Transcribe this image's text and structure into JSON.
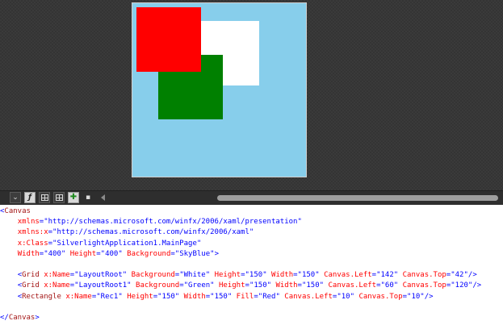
{
  "preview": {
    "canvas_background": "#87CEEB",
    "shapes": [
      {
        "name": "LayoutRoot",
        "fill": "#FFFFFF"
      },
      {
        "name": "LayoutRoot1",
        "fill": "#008000"
      },
      {
        "name": "Rec1",
        "fill": "#FF0000"
      }
    ]
  },
  "toolbar": {
    "buttons": [
      {
        "icon": "chevron-down-icon",
        "glyph": "⌄"
      },
      {
        "icon": "font-icon",
        "glyph": "ƒ"
      },
      {
        "icon": "grid-icon"
      },
      {
        "icon": "grid-snap-icon"
      },
      {
        "icon": "snap-plus-icon",
        "glyph": "✚"
      },
      {
        "icon": "comment-icon",
        "glyph": "▪"
      }
    ],
    "scroll_left_icon": "triangle-left-icon"
  },
  "xaml": {
    "canvas_open": {
      "lt": "<",
      "tag": "Canvas"
    },
    "xmlns": {
      "attr": "xmlns",
      "eq": "=",
      "value": "\"http://schemas.microsoft.com/winfx/2006/xaml/presentation\""
    },
    "xmlns_x": {
      "attr": "xmlns:x",
      "eq": "=",
      "value": "\"http://schemas.microsoft.com/winfx/2006/xaml\""
    },
    "x_class": {
      "attr": "x:Class",
      "eq": "=",
      "value": "\"SilverlightApplication1.MainPage\""
    },
    "size_line": {
      "w_attr": "Width",
      "w_val": "\"400\"",
      "h_attr": "Height",
      "h_val": "\"400\"",
      "bg_attr": "Background",
      "bg_val": "\"SkyBlue\"",
      "gt": ">"
    },
    "grid1": {
      "lt": "<",
      "tag": "Grid",
      "name_attr": "x:Name",
      "name_val": "\"LayoutRoot\"",
      "bg_attr": "Background",
      "bg_val": "\"White\"",
      "h_attr": "Height",
      "h_val": "\"150\"",
      "w_attr": "Width",
      "w_val": "\"150\"",
      "left_attr": "Canvas.Left",
      "left_val": "\"142\"",
      "top_attr": "Canvas.Top",
      "top_val": "\"42\"",
      "end": "/>"
    },
    "grid2": {
      "lt": "<",
      "tag": "Grid",
      "name_attr": "x:Name",
      "name_val": "\"LayoutRoot1\"",
      "bg_attr": "Background",
      "bg_val": "\"Green\"",
      "h_attr": "Height",
      "h_val": "\"150\"",
      "w_attr": "Width",
      "w_val": "\"150\"",
      "left_attr": "Canvas.Left",
      "left_val": "\"60\"",
      "top_attr": "Canvas.Top",
      "top_val": "\"120\"",
      "end": "/>"
    },
    "rect": {
      "lt": "<",
      "tag": "Rectangle",
      "name_attr": "x:Name",
      "name_val": "\"Rec1\"",
      "h_attr": "Height",
      "h_val": "\"150\"",
      "w_attr": "Width",
      "w_val": "\"150\"",
      "fill_attr": "Fill",
      "fill_val": "\"Red\"",
      "left_attr": "Canvas.Left",
      "left_val": "\"10\"",
      "top_attr": "Canvas.Top",
      "top_val": "\"10\"",
      "end": "/>"
    },
    "canvas_close": {
      "lt": "</",
      "tag": "Canvas",
      "gt": ">"
    }
  }
}
